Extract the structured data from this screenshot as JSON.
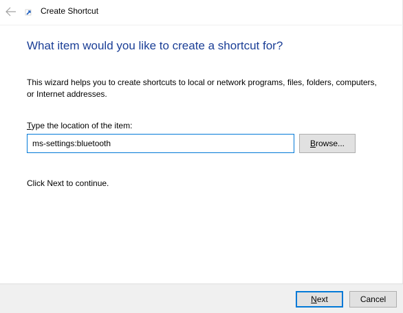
{
  "window": {
    "title": "Create Shortcut",
    "back_icon": "arrow-left-icon",
    "app_icon": "shortcut-wizard-icon"
  },
  "main": {
    "heading": "What item would you like to create a shortcut for?",
    "description": "This wizard helps you to create shortcuts to local or network programs, files, folders, computers, or Internet addresses.",
    "location_label": {
      "accel": "T",
      "rest": "ype the location of the item:"
    },
    "location_value": "ms-settings:bluetooth",
    "browse_button": {
      "accel": "B",
      "rest": "rowse..."
    },
    "continue_text": "Click Next to continue."
  },
  "footer": {
    "next_button": {
      "accel": "N",
      "rest": "ext"
    },
    "cancel_label": "Cancel"
  },
  "colors": {
    "heading": "#1a3e96",
    "accent": "#0078d7",
    "footer_bg": "#f0f0f0",
    "button_bg": "#e1e1e1"
  }
}
